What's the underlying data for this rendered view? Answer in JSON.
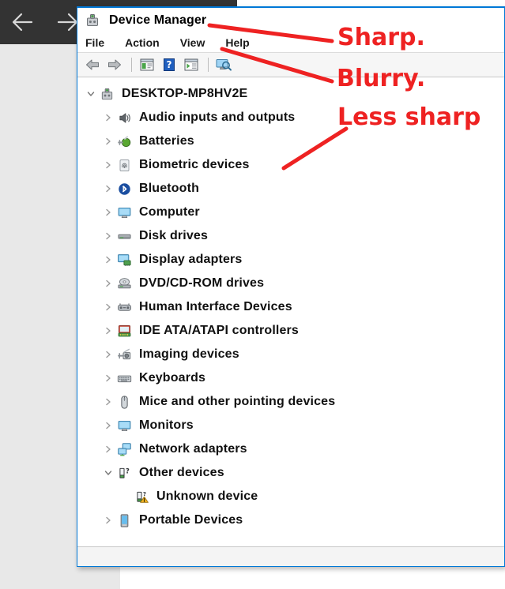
{
  "desktop": {
    "nav_back_label": "Back",
    "nav_forward_label": "Forward"
  },
  "window": {
    "title": "Device Manager",
    "title_icon": "device-manager-icon",
    "menu": [
      {
        "label": "File"
      },
      {
        "label": "Action"
      },
      {
        "label": "View"
      },
      {
        "label": "Help"
      }
    ],
    "toolbar": [
      {
        "name": "back-arrow-icon",
        "title": "Back"
      },
      {
        "name": "forward-arrow-icon",
        "title": "Forward"
      },
      {
        "name": "separator",
        "title": ""
      },
      {
        "name": "show-hide-console-tree-icon",
        "title": "Show/Hide console tree"
      },
      {
        "name": "help-icon",
        "title": "Help"
      },
      {
        "name": "properties-icon",
        "title": "Properties"
      },
      {
        "name": "separator",
        "title": ""
      },
      {
        "name": "scan-for-hardware-changes-icon",
        "title": "Scan for hardware changes"
      }
    ]
  },
  "tree": {
    "nodes": [
      {
        "label": "DESKTOP-MP8HV2E",
        "depth": 0,
        "state": "expanded",
        "icon": "computer-root-icon"
      },
      {
        "label": "Audio inputs and outputs",
        "depth": 1,
        "state": "collapsed",
        "icon": "speaker-icon"
      },
      {
        "label": "Batteries",
        "depth": 1,
        "state": "collapsed",
        "icon": "battery-icon"
      },
      {
        "label": "Biometric devices",
        "depth": 1,
        "state": "collapsed",
        "icon": "fingerprint-icon"
      },
      {
        "label": "Bluetooth",
        "depth": 1,
        "state": "collapsed",
        "icon": "bluetooth-icon"
      },
      {
        "label": "Computer",
        "depth": 1,
        "state": "collapsed",
        "icon": "monitor-icon"
      },
      {
        "label": "Disk drives",
        "depth": 1,
        "state": "collapsed",
        "icon": "disk-drive-icon"
      },
      {
        "label": "Display adapters",
        "depth": 1,
        "state": "collapsed",
        "icon": "display-adapter-icon"
      },
      {
        "label": "DVD/CD-ROM drives",
        "depth": 1,
        "state": "collapsed",
        "icon": "optical-drive-icon"
      },
      {
        "label": "Human Interface Devices",
        "depth": 1,
        "state": "collapsed",
        "icon": "hid-icon"
      },
      {
        "label": "IDE ATA/ATAPI controllers",
        "depth": 1,
        "state": "collapsed",
        "icon": "ide-controller-icon"
      },
      {
        "label": "Imaging devices",
        "depth": 1,
        "state": "collapsed",
        "icon": "camera-icon"
      },
      {
        "label": "Keyboards",
        "depth": 1,
        "state": "collapsed",
        "icon": "keyboard-icon"
      },
      {
        "label": "Mice and other pointing devices",
        "depth": 1,
        "state": "collapsed",
        "icon": "mouse-icon"
      },
      {
        "label": "Monitors",
        "depth": 1,
        "state": "collapsed",
        "icon": "monitor-icon"
      },
      {
        "label": "Network adapters",
        "depth": 1,
        "state": "collapsed",
        "icon": "network-adapter-icon"
      },
      {
        "label": "Other devices",
        "depth": 1,
        "state": "expanded",
        "icon": "unknown-device-icon"
      },
      {
        "label": "Unknown device",
        "depth": 2,
        "state": "leaf",
        "icon": "unknown-device-warning-icon"
      },
      {
        "label": "Portable Devices",
        "depth": 1,
        "state": "collapsed",
        "icon": "portable-device-icon"
      }
    ]
  },
  "annotations": [
    {
      "text": "Sharp.",
      "points_to": "window-title"
    },
    {
      "text": "Blurry.",
      "points_to": "menu-bar"
    },
    {
      "text": "Less sharp",
      "points_to": "tree-node-batteries"
    }
  ],
  "colors": {
    "accent": "#0078d7",
    "annotation_red": "#ee2222",
    "window_bg": "#ffffff",
    "desktop_gray": "#e8e8e8",
    "dark_bar": "#333333"
  }
}
